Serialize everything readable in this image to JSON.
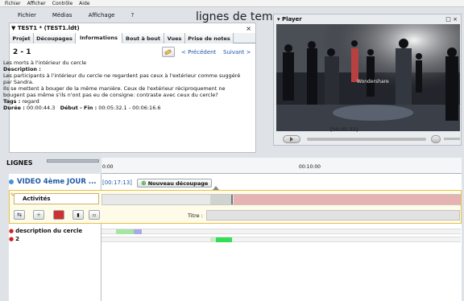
{
  "os_menu": [
    "Fichier",
    "Afficher",
    "Contrôle",
    "Aide"
  ],
  "app_menu": [
    "Fichier",
    "Médias",
    "Affichage",
    "?"
  ],
  "app_title": "lignes de temps",
  "project": {
    "name": "TEST1 * (TEST1.ldt)"
  },
  "tabs": [
    "Projet",
    "Découpages",
    "Informations",
    "Bout à bout",
    "Vues",
    "Prise de notes"
  ],
  "active_tab": "Informations",
  "segment": {
    "number": "2 - 1",
    "prev_label": "< Précédent",
    "next_label": "Suivant >",
    "title": "Les morts à l'intérieur du cercle",
    "description_label": "Description :",
    "description_1": "Les participants à l'intérieur du cercle ne regardent pas ceux à l'extérieur comme suggéré par Sandra.",
    "description_2": "Ils se mettent à bouger de la même manière. Ceux de l'extérieur réciproquement ne bougent pas même s'ils n'ont pas eu de consigne: contraste avec ceux du cercle?",
    "tags_label": "Tags :",
    "tags_value": "regard",
    "duration_label": "Durée :",
    "duration_value": "00:00:44.3",
    "range_label": "Début - Fin :",
    "range_value": "00:05:32.1 - 00:06:16.6"
  },
  "player": {
    "title": "Player",
    "timecode": "[00:05:32]",
    "watermark": "Wondershare"
  },
  "timeline": {
    "header_label": "LIGNES",
    "ruler_start": "0:00",
    "ruler_mid": "00:10:00",
    "video_label": "VIDEO 4ème JOUR ...",
    "video_time": "[00:17:13]",
    "new_cut_label": "Nouveau découpage",
    "activity_name": "Activités",
    "titre_label": "Titre :",
    "rows": [
      {
        "label": "description du cercle"
      },
      {
        "label": "2"
      }
    ]
  },
  "colors": {
    "link": "#2255aa",
    "video_label": "#1f5aa6",
    "activity_border": "#e4c24a",
    "activity_segment": "#e7b2b2",
    "green_segment": "#33dd55",
    "light_green_segment": "#a5e6a5",
    "purple_segment": "#a9a9e8"
  }
}
